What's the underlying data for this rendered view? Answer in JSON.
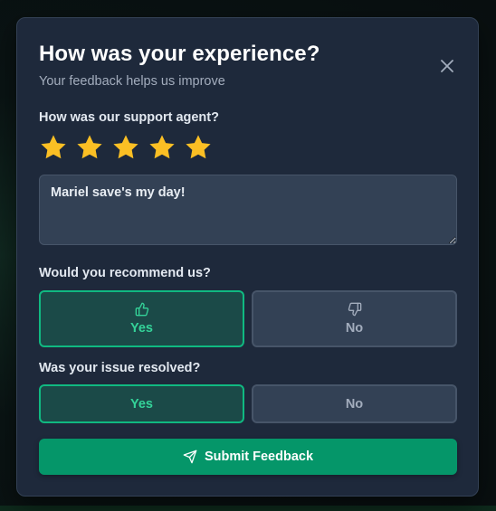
{
  "modal": {
    "title": "How was your experience?",
    "subtitle": "Your feedback helps us improve"
  },
  "rating": {
    "question": "How was our support agent?",
    "value": 5,
    "max": 5,
    "star_color": "#fbbf24"
  },
  "comment": {
    "value": "Mariel save's my day!"
  },
  "recommend": {
    "question": "Would you recommend us?",
    "yes_label": "Yes",
    "no_label": "No",
    "selected": "Yes",
    "yes_icon": "thumbs-up-icon",
    "no_icon": "thumbs-down-icon"
  },
  "resolved": {
    "question": "Was your issue resolved?",
    "yes_label": "Yes",
    "no_label": "No",
    "selected": "Yes"
  },
  "submit": {
    "label": "Submit Feedback",
    "icon": "send-icon"
  },
  "colors": {
    "accent": "#10b981",
    "button": "#059669",
    "panel": "#1e293b"
  }
}
